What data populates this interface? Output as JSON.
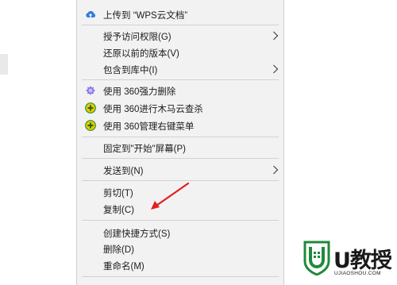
{
  "menu": {
    "items": [
      {
        "label": "上传到 “WPS云文档”",
        "icon": "cloud-upload-icon"
      },
      {
        "label": "授予访问权限(G)",
        "submenu": true
      },
      {
        "label": "还原以前的版本(V)"
      },
      {
        "label": "包含到库中(I)",
        "submenu": true
      },
      {
        "label": "使用 360强力删除",
        "icon": "360-shred-icon"
      },
      {
        "label": "使用 360进行木马云查杀",
        "icon": "360-scan-icon"
      },
      {
        "label": "使用 360管理右键菜单",
        "icon": "360-manage-icon"
      },
      {
        "label": "固定到\"开始\"屏幕(P)"
      },
      {
        "label": "发送到(N)",
        "submenu": true
      },
      {
        "label": "剪切(T)"
      },
      {
        "label": "复制(C)"
      },
      {
        "label": "创建快捷方式(S)"
      },
      {
        "label": "删除(D)"
      },
      {
        "label": "重命名(M)"
      }
    ]
  },
  "annotation": {
    "color": "#e02020"
  },
  "watermark": {
    "title": "U教授",
    "subtitle": "UJIAOSHOU.COM",
    "color": "#1f8a3a"
  }
}
